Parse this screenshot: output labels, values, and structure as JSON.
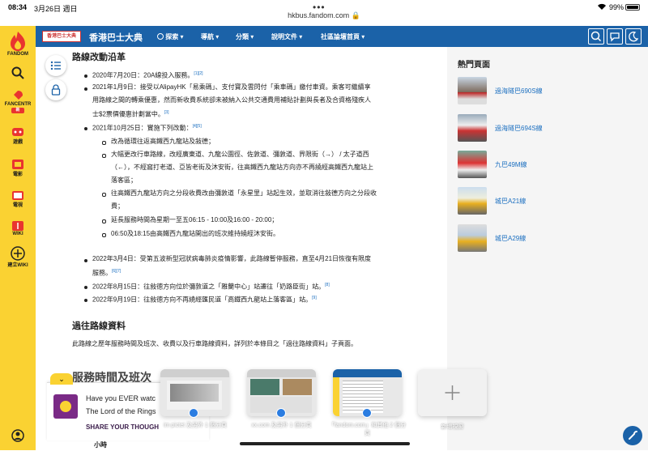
{
  "status": {
    "time": "08:34",
    "date": "3月26日 週日",
    "url": "hkbus.fandom.com",
    "battery": "99%"
  },
  "rail": [
    {
      "name": "fandom",
      "label": "FANDOM"
    },
    {
      "name": "search",
      "label": ""
    },
    {
      "name": "fancentral",
      "label": "FANCENTR"
    },
    {
      "name": "games",
      "label": "遊戲"
    },
    {
      "name": "movies",
      "label": "電影"
    },
    {
      "name": "tv",
      "label": "電視"
    },
    {
      "name": "wiki",
      "label": "WIKI"
    },
    {
      "name": "create-wiki",
      "label": "建立WIKI"
    }
  ],
  "nav": {
    "site_name": "香港巴士大典",
    "logo_text": "香港巴士大典",
    "items": [
      "探索",
      "導航",
      "分類",
      "說明文件",
      "社區論壇首頁"
    ]
  },
  "article": {
    "section1": "路線改動沿革",
    "l1": "2020年7月20日：20A線投入服務。",
    "l1_ref": "[1][2]",
    "l2a": "2021年1月9日：接受以AlipayHK「易乘碼」、支付寶及雲閃付「乘車碼」繳付車資。乘客可繼續享",
    "l2b": "用路線之間的轉乘優惠，然而新收費系統卻未被納入公共交通費用補貼計劃與長者及合資格殘疾人",
    "l2c": "士$2票價優惠計劃當中。",
    "l2_ref": "[3]",
    "l3": "2021年10月25日：實施下列改動：",
    "l3_ref": "[4][5]",
    "s1": "改為循環往返高鐵西九龍站及敍德；",
    "s2a": "大幅更改行車路線，改經廣東道、九龍公園徑、佐敦道、彌敦道、界限街（→） / 太子道西",
    "s2b": "（←），不經窩打老道、亞皆老街及沐安街，往高鐵西九龍站方向亦不再繞經高鐵西九龍站上",
    "s2c": "落客區；",
    "s3a": "往高鐵西九龍站方向之分段收費改由彌敦道「永星里」站起生效，並取消往敍德方向之分段收",
    "s3b": "費；",
    "s4": "延長服務時間為星期一至五06:15 - 10:00及16:00 - 20:00；",
    "s5": "06:50及18:15由高鐵西九龍站開出的班次維持繞經沐安街。",
    "l4a": "2022年3月4日：受第五波新型冠狀病毒肺炎疫情影響，此路線暫停服務，直至4月21日恢復有限度",
    "l4b": "服務。",
    "l4_ref": "[6][7]",
    "l5": "2022年8月15日：往敍德方向位於彌敦道之「雅蘭中心」站遷往「奶路臣街」站。",
    "l5_ref": "[8]",
    "l6": "2022年9月19日：往敍德方向不再繞經匯民道「高鐵西九龍站上落客區」站。",
    "l6_ref": "[9]",
    "section2": "過往路線資料",
    "past": "此路線之歷年服務時間及班次、收費以及行車路線資料，詳列於本條目之「過往路線資料」子頁面。",
    "section3": "服務時間及班次",
    "table_head": "小時"
  },
  "popular": {
    "title": "熱門頁面",
    "items": [
      "過海隧巴690S線",
      "過海隧巴694S線",
      "九巴49M線",
      "城巴A21線",
      "城巴A29線"
    ]
  },
  "ad": {
    "line1": "Have you EVER watc",
    "line2": "The Lord of the Rings",
    "cta": "SHARE YOUR THOUGH"
  },
  "switcher": {
    "cards": [
      "im pictet 及另外 1 個分頁",
      "xx.com 及另外 1 個分頁",
      "「fandom.com」和其他 2 個分頁"
    ],
    "new_tab": "新增視窗"
  },
  "colors": {
    "fandom_yellow": "#fad232",
    "nav_blue": "#1b62a8",
    "link": "#1b6fc0"
  }
}
